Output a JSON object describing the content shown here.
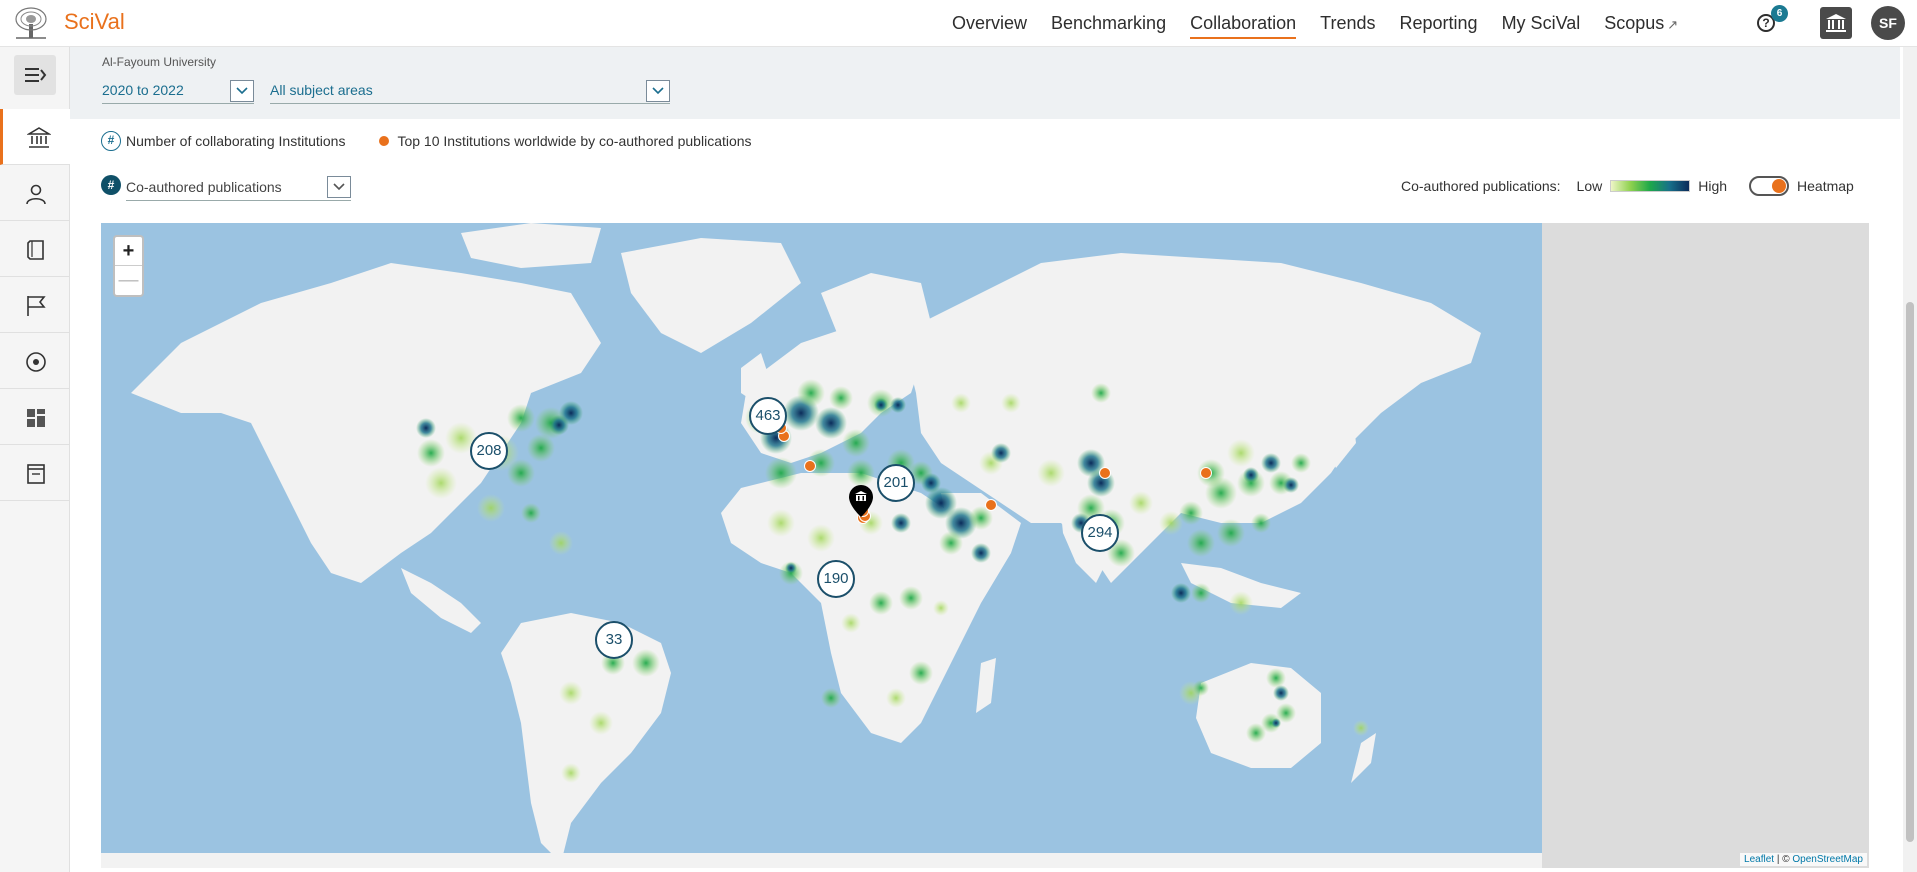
{
  "app": {
    "name": "SciVal"
  },
  "nav": {
    "items": [
      {
        "label": "Overview"
      },
      {
        "label": "Benchmarking"
      },
      {
        "label": "Collaboration"
      },
      {
        "label": "Trends"
      },
      {
        "label": "Reporting"
      },
      {
        "label": "My SciVal"
      },
      {
        "label": "Scopus"
      }
    ],
    "active": "Collaboration",
    "scopus_arrow": "↗",
    "help_badge": "6",
    "avatar_initials": "SF"
  },
  "filters": {
    "institution": "Al-Fayoum University",
    "year_range": "2020 to 2022",
    "subject_area": "All subject areas"
  },
  "legend": {
    "collab_hash": "#",
    "collab_label": "Number of collaborating Institutions",
    "top10_label": "Top 10 Institutions worldwide by co-authored publications"
  },
  "metric": {
    "hash": "#",
    "selected": "Co-authored publications"
  },
  "heat_legend": {
    "title": "Co-authored publications:",
    "low": "Low",
    "high": "High",
    "toggle_label": "Heatmap",
    "toggle_on": true
  },
  "map": {
    "zoom_in": "+",
    "zoom_out": "—",
    "clusters": [
      {
        "value": "463",
        "region": "Western Europe"
      },
      {
        "value": "208",
        "region": "North America"
      },
      {
        "value": "201",
        "region": "Middle East"
      },
      {
        "value": "294",
        "region": "East Asia"
      },
      {
        "value": "190",
        "region": "Africa"
      },
      {
        "value": "33",
        "region": "South America"
      }
    ],
    "attribution": {
      "leaflet": "Leaflet",
      "separator": " | © ",
      "osm": "OpenStreetMap"
    }
  },
  "colors": {
    "accent": "#e9711c",
    "ocean": "#9bc3e1",
    "land": "#f2f2f2",
    "cluster_border": "#1b4f6a"
  }
}
